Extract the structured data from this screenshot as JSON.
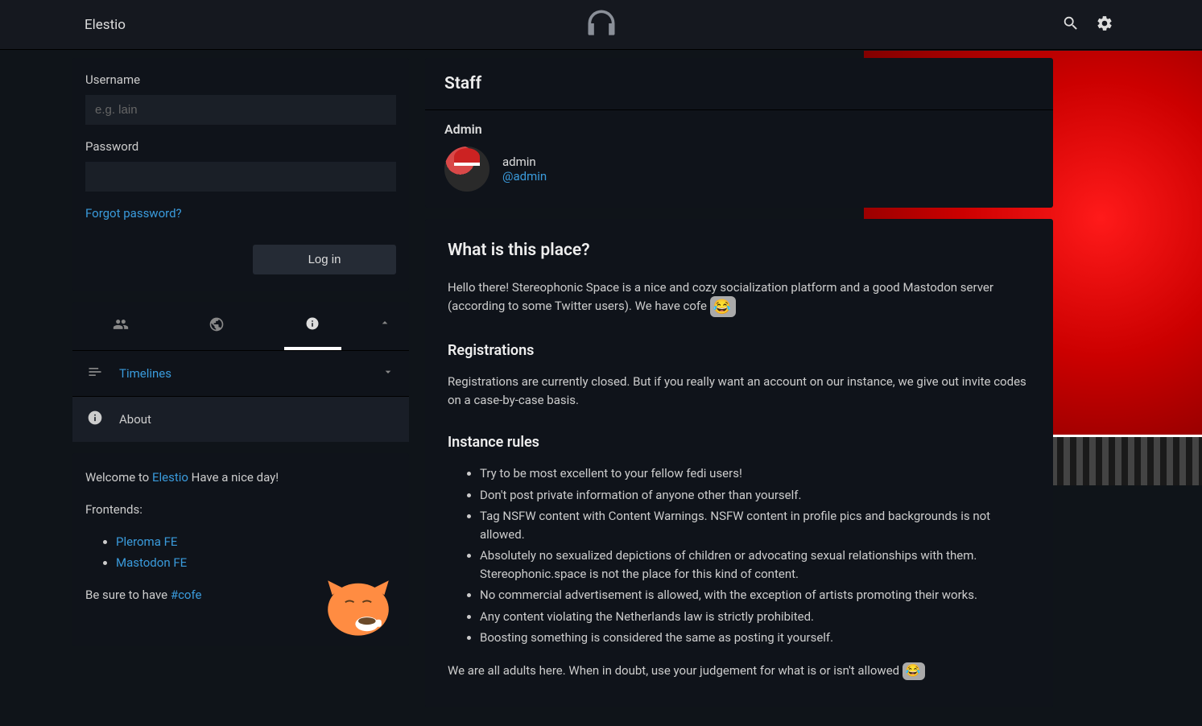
{
  "topbar": {
    "brand": "Elestio"
  },
  "login": {
    "username_label": "Username",
    "username_placeholder": "e.g. lain",
    "password_label": "Password",
    "forgot_link": "Forgot password?",
    "login_button": "Log in"
  },
  "nav": {
    "timelines_label": "Timelines",
    "about_label": "About"
  },
  "welcome": {
    "intro_prefix": "Welcome to ",
    "intro_link": "Elestio",
    "intro_suffix": " Have a nice day!",
    "frontends_label": "Frontends:",
    "frontends": [
      "Pleroma FE",
      "Mastodon FE"
    ],
    "closing_prefix": "Be sure to have ",
    "closing_hashtag": "#cofe"
  },
  "staff": {
    "header": "Staff",
    "section_label": "Admin",
    "name": "admin",
    "handle": "@admin"
  },
  "about": {
    "h2": "What is this place?",
    "intro": "Hello there! Stereophonic Space is a nice and cozy socialization platform and a good Mastodon server (according to some Twitter users). We have cofe ",
    "reg_header": "Registrations",
    "reg_text": "Registrations are currently closed. But if you really want an account on our instance, we give out invite codes on a case-by-case basis.",
    "rules_header": "Instance rules",
    "rules": [
      "Try to be most excellent to your fellow fedi users!",
      "Don't post private information of anyone other than yourself.",
      "Tag NSFW content with Content Warnings. NSFW content in profile pics and backgrounds is not allowed.",
      "Absolutely no sexualized depictions of children or advocating sexual relationships with them. Stereophonic.space is not the place for this kind of content.",
      "No commercial advertisement is allowed, with the exception of artists promoting their works.",
      "Any content violating the Netherlands law is strictly prohibited.",
      "Boosting something is considered the same as posting it yourself."
    ],
    "closing": "We are all adults here. When in doubt, use your judgement for what is or isn't allowed "
  }
}
